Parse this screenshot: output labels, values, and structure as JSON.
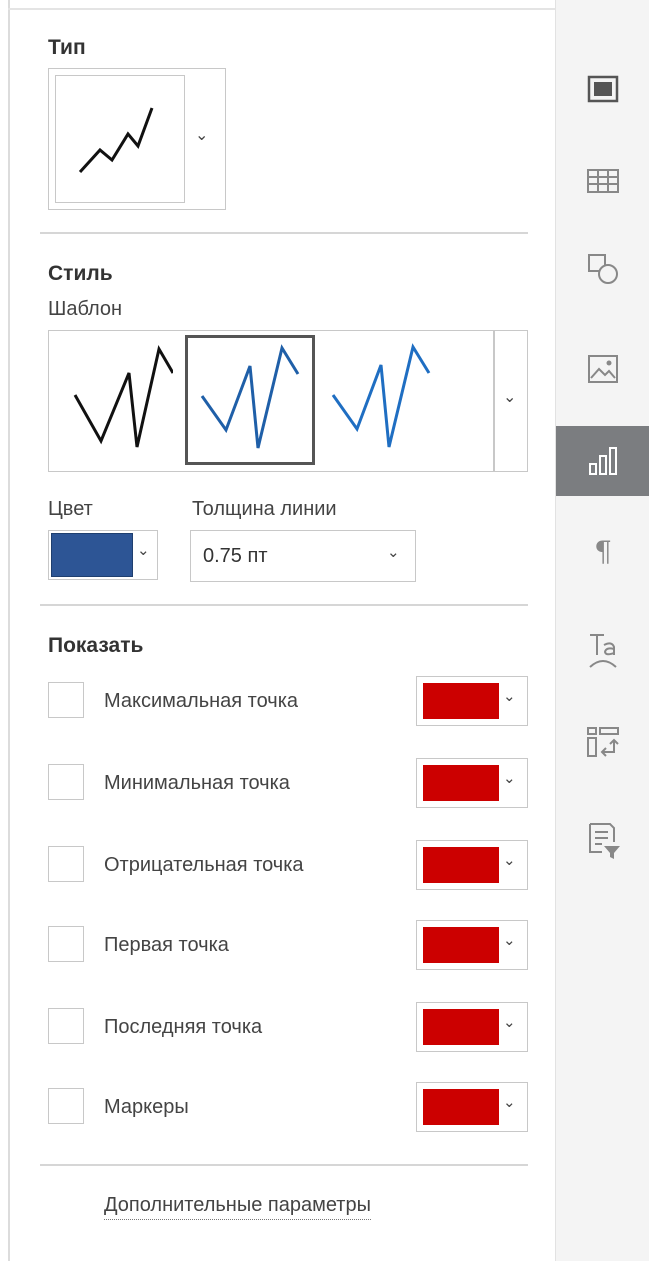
{
  "type_section": {
    "title": "Тип"
  },
  "style_section": {
    "title": "Стиль",
    "template_label": "Шаблон",
    "templates": [
      {
        "name": "black-line",
        "color": "#111111"
      },
      {
        "name": "blue-line-selected",
        "color": "#1f5fa8"
      },
      {
        "name": "blue-line",
        "color": "#1f6ec2"
      }
    ],
    "color_label": "Цвет",
    "color_value": "#2d5595",
    "thickness_label": "Толщина линии",
    "thickness_value": "0.75 пт"
  },
  "show_section": {
    "title": "Показать",
    "items": [
      {
        "label": "Максимальная точка",
        "checked": false,
        "color": "#cc0000"
      },
      {
        "label": "Минимальная точка",
        "checked": false,
        "color": "#cc0000"
      },
      {
        "label": "Отрицательная точка",
        "checked": false,
        "color": "#cc0000"
      },
      {
        "label": "Первая точка",
        "checked": false,
        "color": "#cc0000"
      },
      {
        "label": "Последняя точка",
        "checked": false,
        "color": "#cc0000"
      },
      {
        "label": "Маркеры",
        "checked": false,
        "color": "#cc0000"
      }
    ]
  },
  "more_link": "Дополнительные параметры",
  "toolbar": {
    "active_item": "sparkline-settings",
    "items": [
      {
        "icon": "slide-settings-icon"
      },
      {
        "icon": "table-settings-icon"
      },
      {
        "icon": "shape-settings-icon"
      },
      {
        "icon": "image-settings-icon"
      },
      {
        "icon": "sparkline-settings-icon"
      },
      {
        "icon": "paragraph-settings-icon"
      },
      {
        "icon": "text-art-settings-icon"
      },
      {
        "icon": "pivot-settings-icon"
      },
      {
        "icon": "signature-settings-icon"
      }
    ]
  }
}
